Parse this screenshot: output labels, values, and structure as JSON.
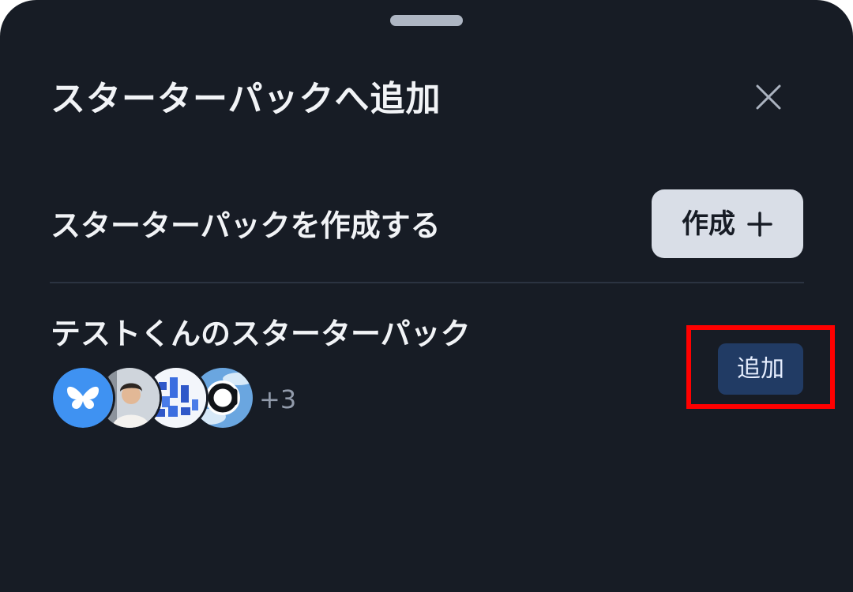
{
  "sheet": {
    "title": "スターターパックへ追加",
    "close_icon": "close-icon"
  },
  "create_section": {
    "label": "スターターパックを作成する",
    "button_label": "作成",
    "button_icon": "plus-icon"
  },
  "starter_pack": {
    "title": "テストくんのスターターパック",
    "avatars": [
      "butterfly-avatar",
      "person-photo-avatar",
      "blue-blocks-avatar",
      "at-sign-avatar"
    ],
    "more_count": "+3",
    "add_button_label": "追加"
  },
  "colors": {
    "sheet_background": "#171c25",
    "text_primary": "#f1f3f6",
    "text_muted": "#929bab",
    "create_button_bg": "#d9dee7",
    "add_button_bg": "#213b64",
    "highlight": "#ff0000"
  }
}
